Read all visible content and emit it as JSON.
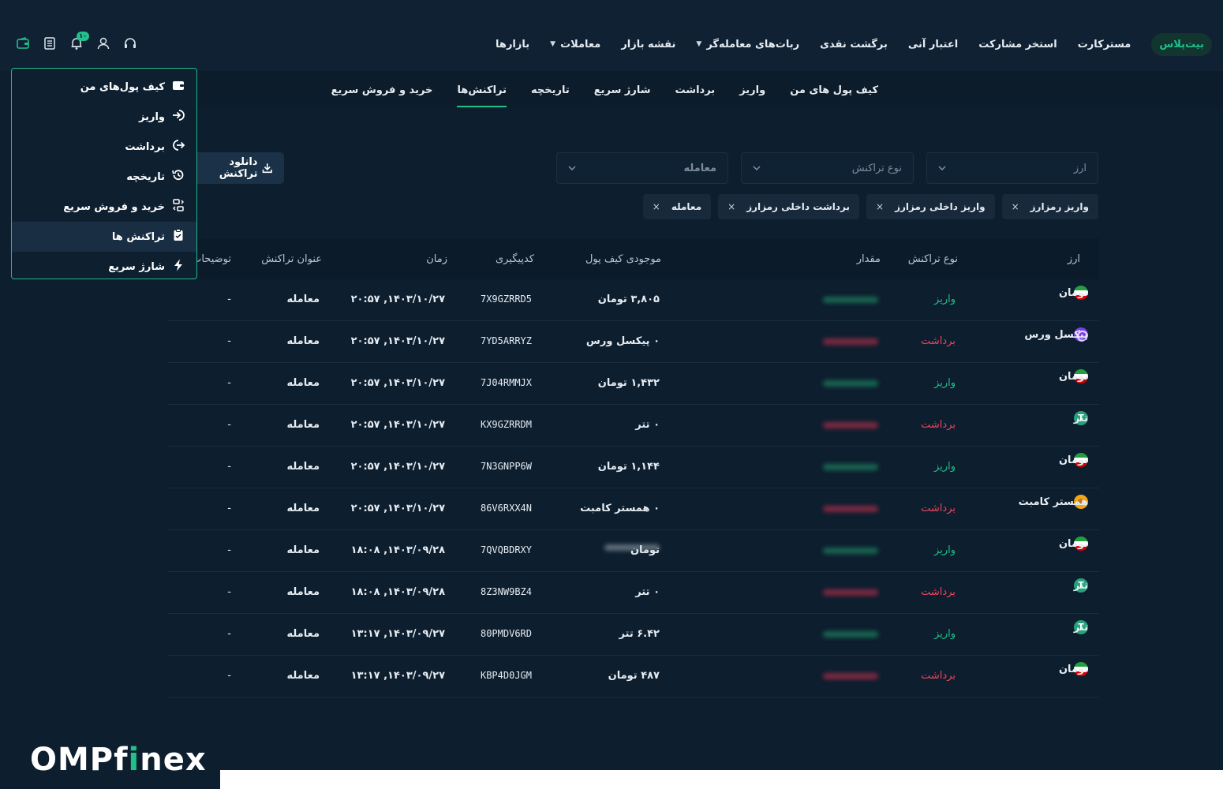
{
  "nav": {
    "items": [
      {
        "label": "بازارها",
        "caret": false
      },
      {
        "label": "معاملات",
        "caret": true
      },
      {
        "label": "نقشه بازار",
        "caret": false
      },
      {
        "label": "ربات‌های معامله‌گر",
        "caret": true
      },
      {
        "label": "برگشت نقدی",
        "caret": false
      },
      {
        "label": "اعتبار آنی",
        "caret": false
      },
      {
        "label": "استخر مشارکت",
        "caret": false
      },
      {
        "label": "مسترکارت",
        "caret": false
      }
    ],
    "pill": "بیت‌پلاس",
    "notification_count": "۱۰"
  },
  "subtabs": [
    {
      "label": "کیف پول های من",
      "active": false
    },
    {
      "label": "واریز",
      "active": false
    },
    {
      "label": "برداشت",
      "active": false
    },
    {
      "label": "شارژ سریع",
      "active": false
    },
    {
      "label": "تاریخچه",
      "active": false
    },
    {
      "label": "تراکنش‌ها",
      "active": true
    },
    {
      "label": "خرید و فروش سریع",
      "active": false
    }
  ],
  "filters": {
    "currency_placeholder": "ارز",
    "type_placeholder": "نوع تراکنش",
    "title_value": "معامله",
    "download_label": "دانلود تراکنش"
  },
  "chips": [
    "واریز رمزارز",
    "واریز داخلی رمزارز",
    "برداشت داخلی رمزارز",
    "معامله"
  ],
  "chip_close": "×",
  "table": {
    "headers": {
      "currency": "ارز",
      "type": "نوع تراکنش",
      "amount": "مقدار",
      "balance": "موجودی کیف پول",
      "tracking": "کدپیگیری",
      "time": "زمان",
      "title": "عنوان تراکنش",
      "desc": "توضیحات"
    },
    "rows": [
      {
        "currency": "تومان",
        "coin": "toman",
        "type": "واریز",
        "kind": "dep",
        "balance": "۳,۸۰۵ تومان",
        "tracking": "7X9GZRRD5",
        "time": "۲۰:۵۷ ,۱۴۰۳/۱۰/۲۷",
        "title": "معامله",
        "desc": "-"
      },
      {
        "currency": "پیکسل ورس",
        "coin": "pixel",
        "type": "برداشت",
        "kind": "wd",
        "balance": "۰ پیکسل ورس",
        "tracking": "7YD5ARRYZ",
        "time": "۲۰:۵۷ ,۱۴۰۳/۱۰/۲۷",
        "title": "معامله",
        "desc": "-"
      },
      {
        "currency": "تومان",
        "coin": "toman",
        "type": "واریز",
        "kind": "dep",
        "balance": "۱,۴۳۲ تومان",
        "tracking": "7J04RMMJX",
        "time": "۲۰:۵۷ ,۱۴۰۳/۱۰/۲۷",
        "title": "معامله",
        "desc": "-"
      },
      {
        "currency": "تتر",
        "coin": "tether",
        "type": "برداشت",
        "kind": "wd",
        "balance": "۰ تتر",
        "tracking": "KX9GZRRDM",
        "time": "۲۰:۵۷ ,۱۴۰۳/۱۰/۲۷",
        "title": "معامله",
        "desc": "-"
      },
      {
        "currency": "تومان",
        "coin": "toman",
        "type": "واریز",
        "kind": "dep",
        "balance": "۱,۱۴۴ تومان",
        "tracking": "7N3GNPP6W",
        "time": "۲۰:۵۷ ,۱۴۰۳/۱۰/۲۷",
        "title": "معامله",
        "desc": "-"
      },
      {
        "currency": "همستر کامبت",
        "coin": "hamster",
        "type": "برداشت",
        "kind": "wd",
        "balance": "۰ همستر کامبت",
        "tracking": "86V6RXX4N",
        "time": "۲۰:۵۷ ,۱۴۰۳/۱۰/۲۷",
        "title": "معامله",
        "desc": "-"
      },
      {
        "currency": "تومان",
        "coin": "toman",
        "type": "واریز",
        "kind": "dep",
        "balance": "تومان",
        "balance_blurred": true,
        "tracking": "7QVQBDRXY",
        "time": "۱۸:۰۸ ,۱۴۰۳/۰۹/۲۸",
        "title": "معامله",
        "desc": "-"
      },
      {
        "currency": "تتر",
        "coin": "tether",
        "type": "برداشت",
        "kind": "wd",
        "balance": "۰ تتر",
        "tracking": "8Z3NW9BZ4",
        "time": "۱۸:۰۸ ,۱۴۰۳/۰۹/۲۸",
        "title": "معامله",
        "desc": "-"
      },
      {
        "currency": "تتر",
        "coin": "tether",
        "type": "واریز",
        "kind": "dep",
        "balance": "۶.۴۲ تتر",
        "tracking": "80PMDV6RD",
        "time": "۱۳:۱۷ ,۱۴۰۳/۰۹/۲۷",
        "title": "معامله",
        "desc": "-"
      },
      {
        "currency": "تومان",
        "coin": "toman",
        "type": "برداشت",
        "kind": "wd",
        "balance": "۴۸۷ تومان",
        "tracking": "KBP4D0JGM",
        "time": "۱۳:۱۷ ,۱۴۰۳/۰۹/۲۷",
        "title": "معامله",
        "desc": "-"
      }
    ]
  },
  "wallet_menu": [
    {
      "label": "کیف پول‌های من",
      "icon": "wallet-icon",
      "selected": false
    },
    {
      "label": "واریز",
      "icon": "login-arrow-icon",
      "selected": false
    },
    {
      "label": "برداشت",
      "icon": "logout-arrow-icon",
      "selected": false
    },
    {
      "label": "تاریخچه",
      "icon": "history-icon",
      "selected": false
    },
    {
      "label": "خرید و فروش سریع",
      "icon": "exchange-icon",
      "selected": false
    },
    {
      "label": "تراکنش ها",
      "icon": "clipboard-icon",
      "selected": true
    },
    {
      "label": "شارژ سریع",
      "icon": "lightning-icon",
      "selected": false
    }
  ],
  "logo": {
    "part1": "OMP",
    "part2": "f",
    "part3": "i",
    "part4": "nex"
  },
  "colors": {
    "accent": "#20c08a",
    "withdraw": "#f0455e",
    "background": "#0d1e2e"
  }
}
